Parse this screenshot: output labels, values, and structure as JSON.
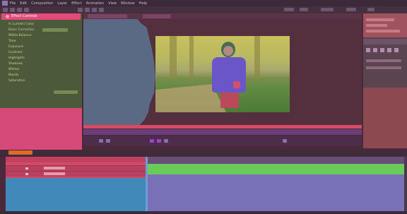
{
  "menu": {
    "items": [
      "File",
      "Edit",
      "Composition",
      "Layer",
      "Effect",
      "Animation",
      "View",
      "Window",
      "Help"
    ]
  },
  "left_panel": {
    "title": "Effect Controls",
    "rows": [
      "fx  Lumetri Color",
      "Basic Correction",
      "White Balance",
      "Tone",
      "Exposure",
      "Contrast",
      "Highlights",
      "Shadows",
      "Whites",
      "Blacks",
      "Saturation"
    ]
  },
  "viewer": {
    "status_text": ""
  },
  "timeline": {
    "tab_label": ""
  },
  "colors": {
    "menubar": "#3b2b3a",
    "left_panel": "#4d5a3a",
    "left_header": "#e24a7a",
    "viewer_bg": "#54303f",
    "timeline_green": "#6acb58",
    "timeline_lavender": "#7a72b8",
    "layers_blue": "#3f8ab8"
  },
  "icons": [
    "app-logo-icon",
    "selection-tool-icon",
    "hand-tool-icon",
    "zoom-tool-icon",
    "pen-tool-icon",
    "text-tool-icon",
    "play-icon",
    "stop-icon"
  ]
}
